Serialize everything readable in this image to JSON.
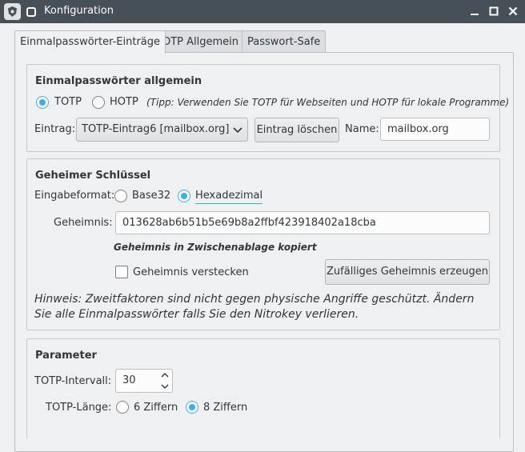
{
  "window": {
    "title": "Konfiguration"
  },
  "tabs": [
    {
      "label": "Einmalpasswörter-Einträge",
      "active": true
    },
    {
      "label": "OTP Allgemein",
      "active": false
    },
    {
      "label": "Passwort-Safe",
      "active": false
    }
  ],
  "otp_general": {
    "title": "Einmalpasswörter allgemein",
    "radio_totp": "TOTP",
    "radio_hotp": "HOTP",
    "selected": "TOTP",
    "tip": "(Tipp: Verwenden Sie TOTP für Webseiten und HOTP für lokale Programme)",
    "entry_label": "Eintrag:",
    "entry_value": "TOTP-Eintrag6 [mailbox.org]",
    "delete_button": "Eintrag löschen",
    "name_label": "Name:",
    "name_value": "mailbox.org"
  },
  "secret": {
    "title": "Geheimer Schlüssel",
    "input_format_label": "Eingabeformat:",
    "format_base32": "Base32",
    "format_hex": "Hexadezimal",
    "selected_format": "Hexadezimal",
    "secret_label": "Geheimnis:",
    "secret_value": "013628ab6b51b5e69b8a2ffbf423918402a18cba",
    "copied_message": "Geheimnis in Zwischenablage kopiert",
    "hide_label": "Geheimnis verstecken",
    "hide_checked": false,
    "generate_button": "Zufälliges Geheimnis erzeugen",
    "hint": "Hinweis: Zweitfaktoren sind nicht gegen physische Angriffe geschützt. Ändern Sie alle Einmalpasswörter falls Sie den Nitrokey verlieren."
  },
  "parameters": {
    "title": "Parameter",
    "interval_label": "TOTP-Intervall:",
    "interval_value": "30",
    "length_label": "TOTP-Länge:",
    "length_6": "6 Ziffern",
    "length_8": "8 Ziffern",
    "selected_length": "8 Ziffern"
  },
  "colors": {
    "titlebar": "#475057",
    "accent": "#3daee9",
    "background": "#eff0f1"
  }
}
